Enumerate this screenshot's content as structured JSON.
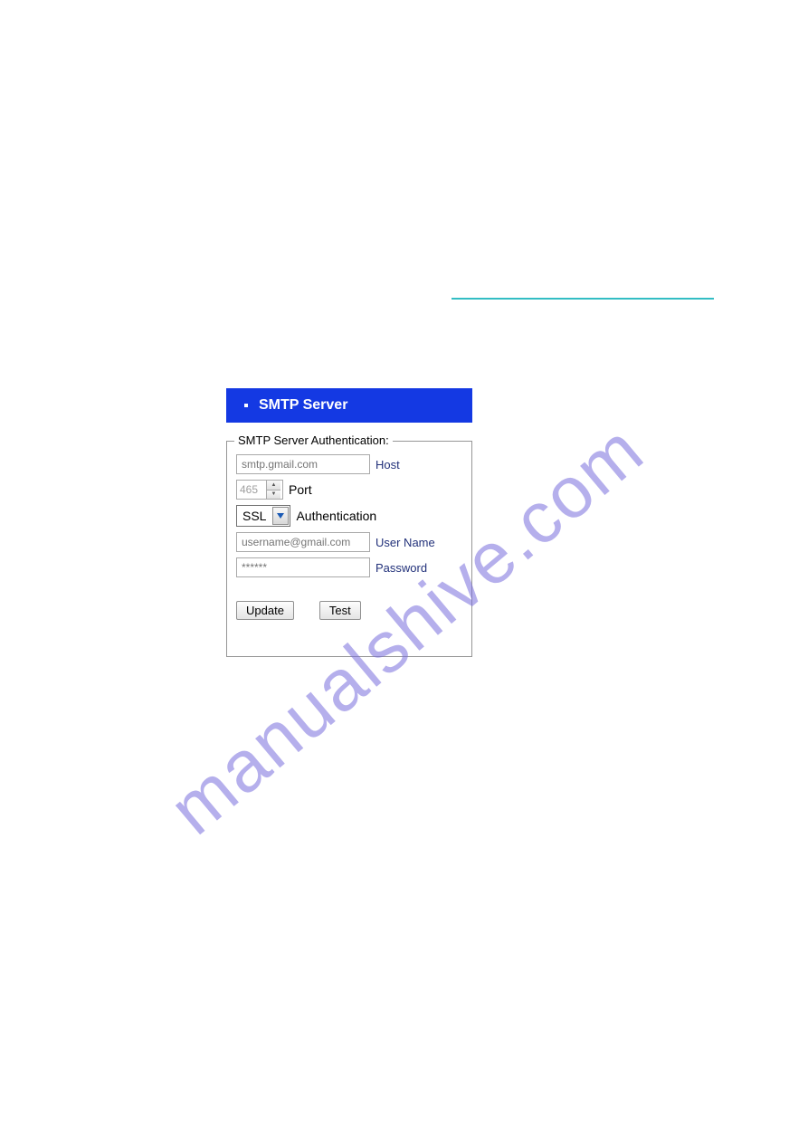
{
  "watermark": "manualshive.com",
  "panel": {
    "title": "SMTP Server",
    "legend": "SMTP Server Authentication:",
    "host": {
      "placeholder": "smtp.gmail.com",
      "label": "Host"
    },
    "port": {
      "value": "465",
      "label": "Port"
    },
    "auth": {
      "value": "SSL",
      "label": "Authentication"
    },
    "username": {
      "placeholder": "username@gmail.com",
      "label": "User Name"
    },
    "password": {
      "placeholder": "******",
      "label": "Password"
    },
    "buttons": {
      "update": "Update",
      "test": "Test"
    }
  }
}
